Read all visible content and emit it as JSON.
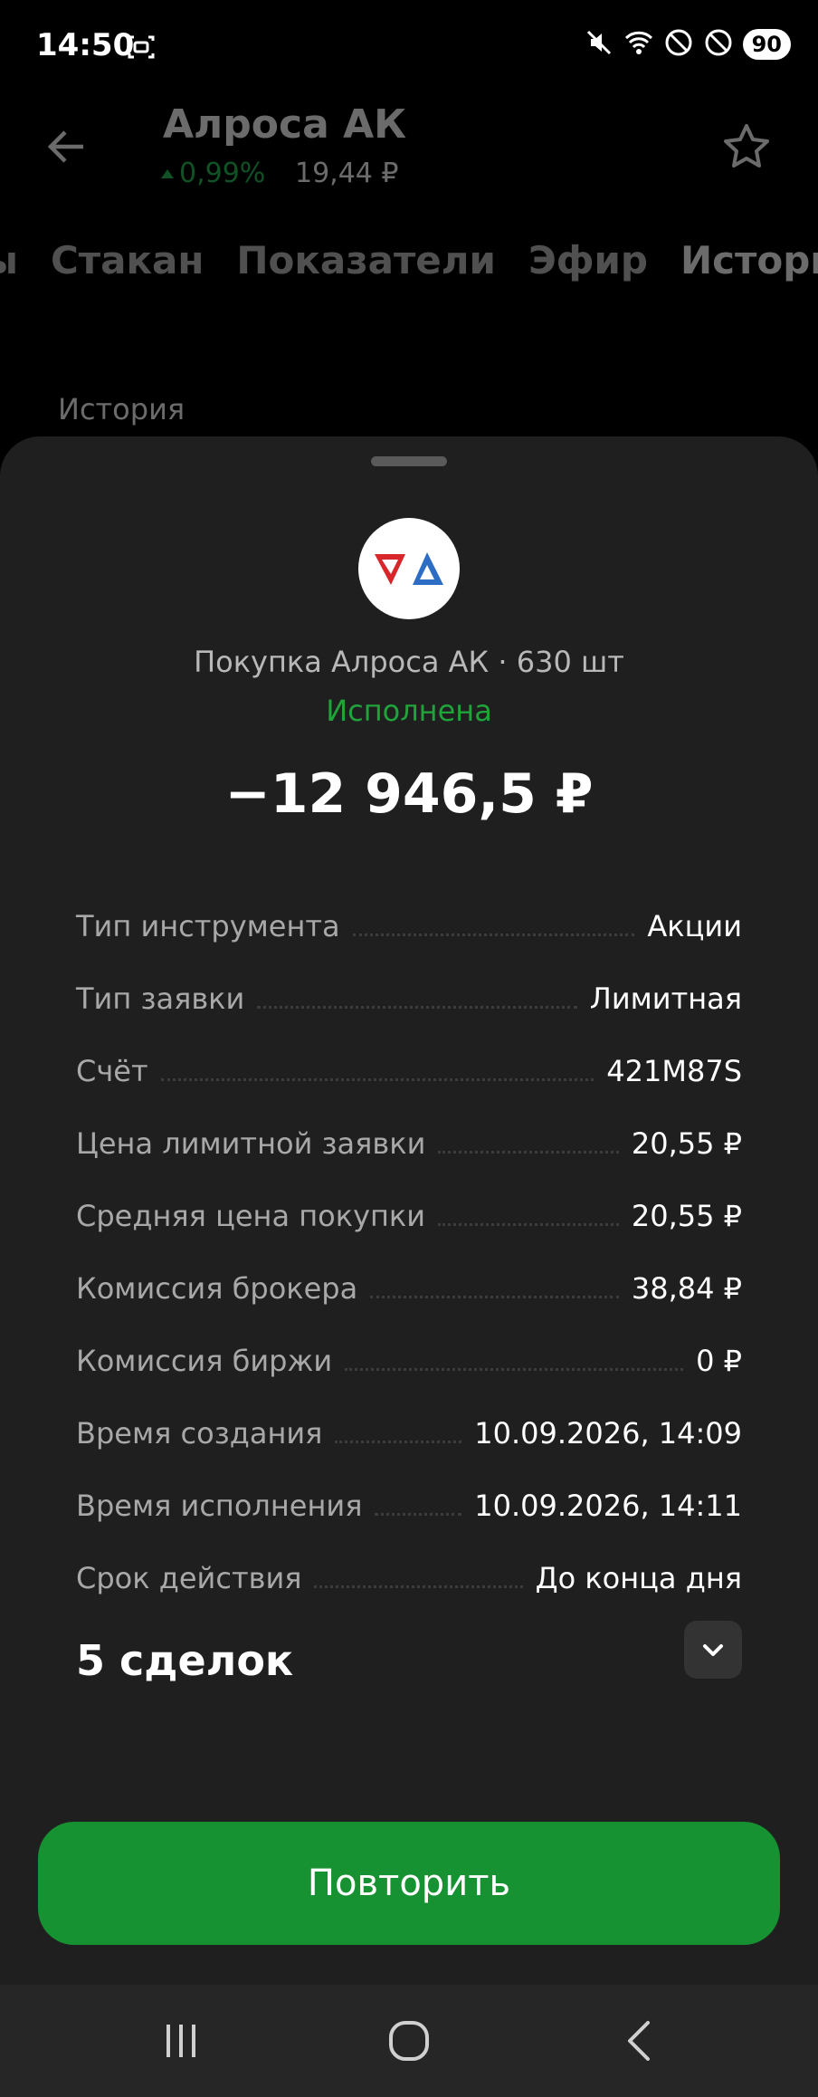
{
  "status_bar": {
    "time": "14:50",
    "battery": "90",
    "icons": [
      "screenshot-icon",
      "mute-icon",
      "wifi-icon",
      "do-not-disturb-icon",
      "blocked-icon"
    ]
  },
  "background_app": {
    "title": "Алроса АК",
    "change": "0,99%",
    "price": "19,44 ₽",
    "tabs": [
      "ы",
      "Стакан",
      "Показатели",
      "Эфир",
      "История"
    ],
    "section": "История",
    "colors": {
      "positive": "#27c25a"
    }
  },
  "sheet": {
    "subtitle": "Покупка Алроса АК · 630 шт",
    "status": "Исполнена",
    "amount": "−12 946,5 ₽",
    "details": [
      {
        "label": "Тип инструмента",
        "value": "Акции"
      },
      {
        "label": "Тип заявки",
        "value": "Лимитная"
      },
      {
        "label": "Счёт",
        "value": "421M87S"
      },
      {
        "label": "Цена лимитной заявки",
        "value": "20,55 ₽"
      },
      {
        "label": "Средняя цена покупки",
        "value": "20,55 ₽"
      },
      {
        "label": "Комиссия брокера",
        "value": "38,84 ₽"
      },
      {
        "label": "Комиссия биржи",
        "value": "0 ₽"
      },
      {
        "label": "Время создания",
        "value": "10.09.2026, 14:09"
      },
      {
        "label": "Время исполнения",
        "value": "10.09.2026, 14:11"
      },
      {
        "label": "Срок действия",
        "value": "До конца дня"
      }
    ],
    "deals_label": "5 сделок",
    "repeat_label": "Повторить",
    "colors": {
      "status": "#1fa33a",
      "button": "#169232"
    }
  }
}
